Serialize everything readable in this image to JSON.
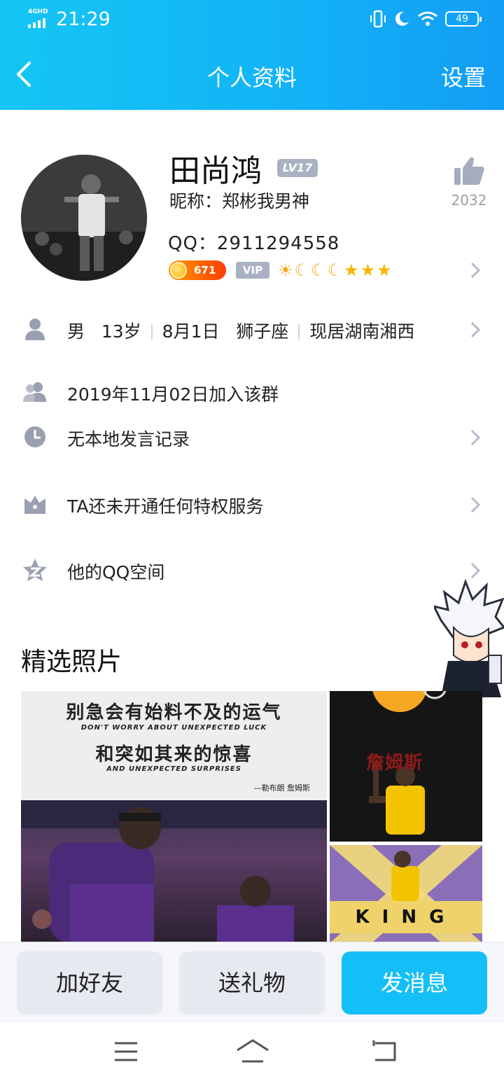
{
  "status_bar": {
    "network": "4GHD",
    "time": "21:29",
    "battery": "49"
  },
  "nav": {
    "title": "个人资料",
    "settings_label": "设置"
  },
  "profile": {
    "name": "田尚鸿",
    "level_badge": "LV17",
    "nickname": "昵称：郑彬我男神",
    "qq_number": "QQ：2911294558",
    "likes": "2032",
    "coin_badge": "671",
    "vip_badge": "VIP"
  },
  "info": {
    "gender": "男",
    "age": "13岁",
    "birthday": "8月1日",
    "zodiac": "狮子座",
    "location": "现居湖南湘西"
  },
  "rows": {
    "join_group": "2019年11月02日加入该群",
    "speech_record": "无本地发言记录",
    "privilege": "TA还未开通任何特权服务",
    "qzone": "他的QQ空间"
  },
  "photos": {
    "section_title": "精选照片",
    "main_line1": "别急会有始料不及的运气",
    "main_line2": "DON'T WORRY ABOUT UNEXPECTED LUCK",
    "main_line3": "和突如其来的惊喜",
    "main_line4": "AND UNEXPECTED SURPRISES",
    "main_credit": "—勒布朗 詹姆斯",
    "right1_text": "詹姆斯",
    "right2_text": "KING"
  },
  "actions": {
    "add_friend": "加好友",
    "send_gift": "送礼物",
    "send_message": "发消息"
  },
  "colors": {
    "header_gradient_start": "#14c6f4",
    "header_gradient_end": "#139df5",
    "primary_button": "#14bff7",
    "secondary_button": "#e7e9f1",
    "icon_grey": "#9aa0b0"
  }
}
